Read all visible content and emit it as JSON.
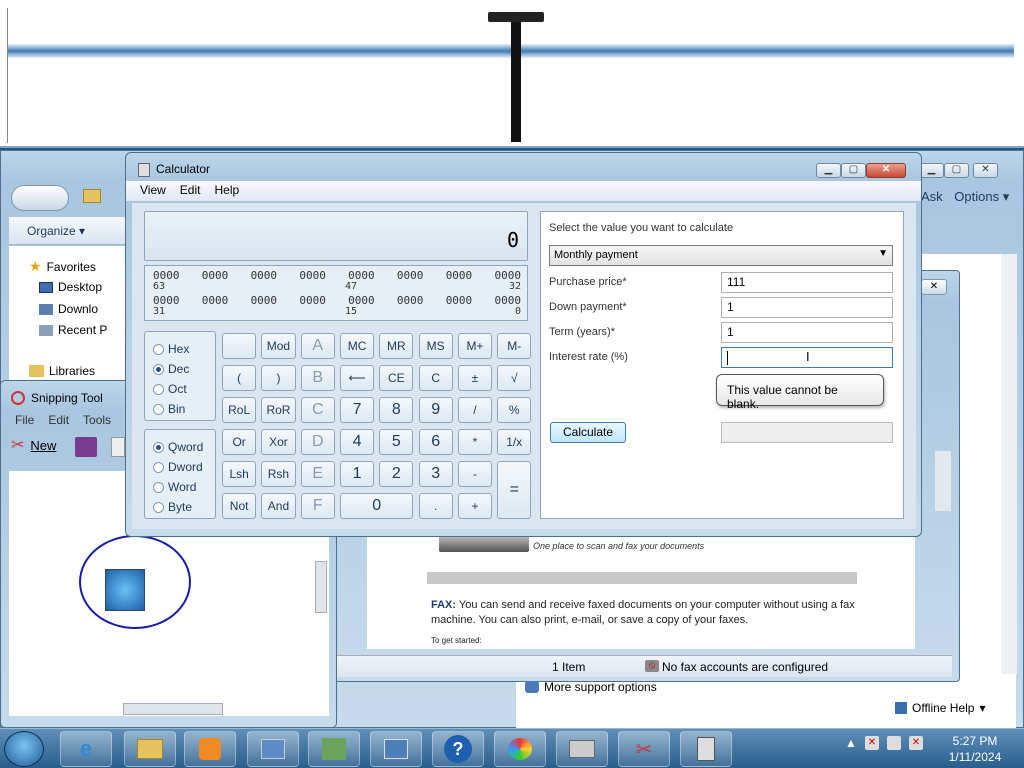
{
  "top_strip": {},
  "explorer": {
    "organize_label": "Organize",
    "sidebar": [
      {
        "label": "Favorites",
        "icon": "star-icon"
      },
      {
        "label": "Desktop",
        "icon": "desktop-icon"
      },
      {
        "label": "Downlo",
        "icon": "download-icon"
      },
      {
        "label": "Recent P",
        "icon": "recent-places-icon"
      },
      {
        "label": "Libraries",
        "icon": "libraries-icon"
      }
    ],
    "status_items": "1 Item",
    "status_fax": "No fax accounts are configured",
    "ask_label": "Ask",
    "options_label": "Options"
  },
  "help_doc": {
    "scan_caption": "One place to scan and fax your documents",
    "fax_heading": "FAX:",
    "fax_text": "You can send and receive faxed documents on your computer without using a fax machine. You can also print, e-mail, or save a copy of your faxes.",
    "get_started": "To get started:",
    "more_support": "More support options",
    "offline_help": "Offline Help"
  },
  "snipping": {
    "title": "Snipping Tool",
    "menu": [
      "File",
      "Edit",
      "Tools"
    ],
    "new_label": "New"
  },
  "calculator": {
    "title": "Calculator",
    "menu": [
      "View",
      "Edit",
      "Help"
    ],
    "display": "0",
    "bits_row1": [
      "0000",
      "0000",
      "0000",
      "0000",
      "0000",
      "0000",
      "0000",
      "0000"
    ],
    "bits_row1_labels": {
      "left": "63",
      "mid": "47",
      "right": "32"
    },
    "bits_row2": [
      "0000",
      "0000",
      "0000",
      "0000",
      "0000",
      "0000",
      "0000",
      "0000"
    ],
    "bits_row2_labels": {
      "left": "31",
      "mid": "15",
      "right": "0"
    },
    "base_options": [
      "Hex",
      "Dec",
      "Oct",
      "Bin"
    ],
    "base_selected": "Dec",
    "word_options": [
      "Qword",
      "Dword",
      "Word",
      "Byte"
    ],
    "word_selected": "Qword",
    "keys": {
      "mod": "Mod",
      "a": "A",
      "mc": "MC",
      "mr": "MR",
      "ms": "MS",
      "mplus": "M+",
      "mminus": "M-",
      "lparen": "(",
      "rparen": ")",
      "b": "B",
      "back": "⟵",
      "ce": "CE",
      "c": "C",
      "pm": "±",
      "sqrt": "√",
      "rol": "RoL",
      "ror": "RoR",
      "cc": "C",
      "k7": "7",
      "k8": "8",
      "k9": "9",
      "div": "/",
      "pct": "%",
      "or": "Or",
      "xor": "Xor",
      "d": "D",
      "k4": "4",
      "k5": "5",
      "k6": "6",
      "mul": "*",
      "inv": "1/x",
      "lsh": "Lsh",
      "rsh": "Rsh",
      "e": "E",
      "k1": "1",
      "k2": "2",
      "k3": "3",
      "sub": "-",
      "eq": "=",
      "not": "Not",
      "and": "And",
      "f": "F",
      "k0": "0",
      "dot": ".",
      "add": "+"
    },
    "worksheet": {
      "prompt": "Select the value you want to calculate",
      "selected": "Monthly payment",
      "fields": [
        {
          "label": "Purchase price*",
          "value": "111"
        },
        {
          "label": "Down payment*",
          "value": "1"
        },
        {
          "label": "Term (years)*",
          "value": "1"
        },
        {
          "label": "Interest rate (%)",
          "value": ""
        }
      ],
      "tooltip": "This value cannot be blank.",
      "calculate": "Calculate"
    }
  },
  "taskbar": {
    "time": "5:27 PM",
    "date": "1/11/2024"
  }
}
